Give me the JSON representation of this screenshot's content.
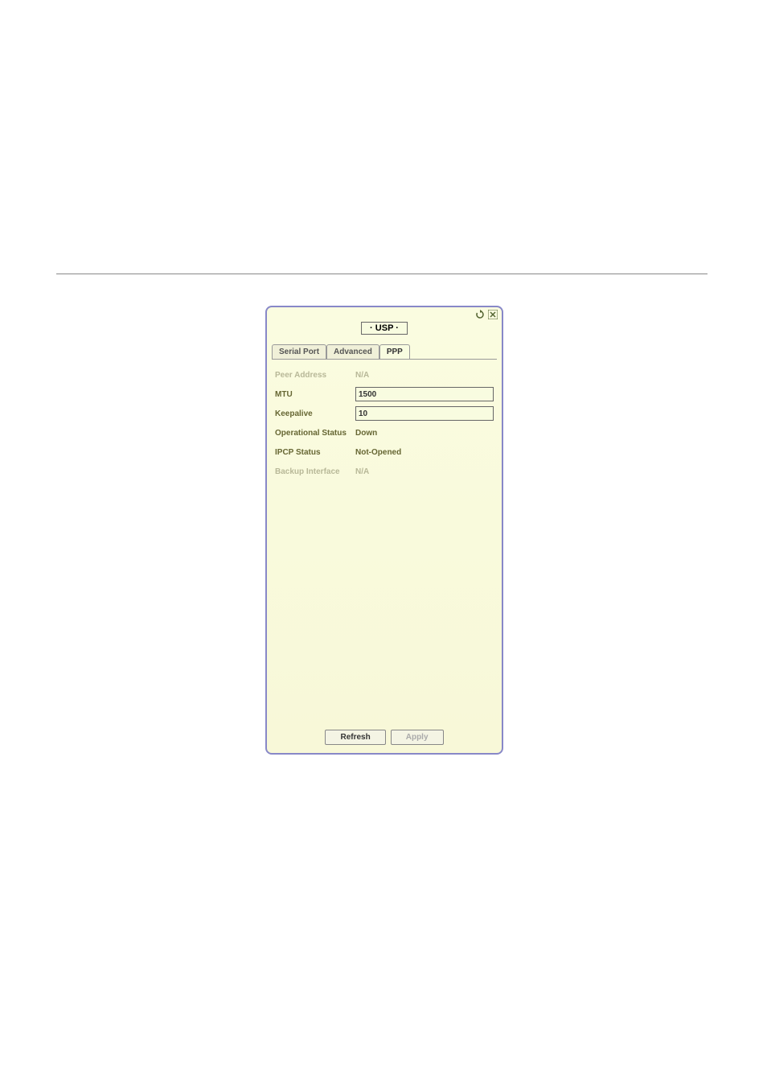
{
  "dialog": {
    "title": "USP",
    "icons": {
      "refresh_icon": "↻",
      "close_icon": "✕"
    },
    "tabs": [
      {
        "label": "Serial Port",
        "active": false
      },
      {
        "label": "Advanced",
        "active": false
      },
      {
        "label": "PPP",
        "active": true
      }
    ],
    "fields": {
      "peer_address": {
        "label": "Peer Address",
        "value": "N/A"
      },
      "mtu": {
        "label": "MTU",
        "value": "1500"
      },
      "keepalive": {
        "label": "Keepalive",
        "value": "10"
      },
      "operational_status": {
        "label": "Operational Status",
        "value": "Down"
      },
      "ipcp_status": {
        "label": "IPCP Status",
        "value": "Not-Opened"
      },
      "backup_interface": {
        "label": "Backup Interface",
        "value": "N/A"
      }
    },
    "buttons": {
      "refresh": "Refresh",
      "apply": "Apply"
    }
  }
}
